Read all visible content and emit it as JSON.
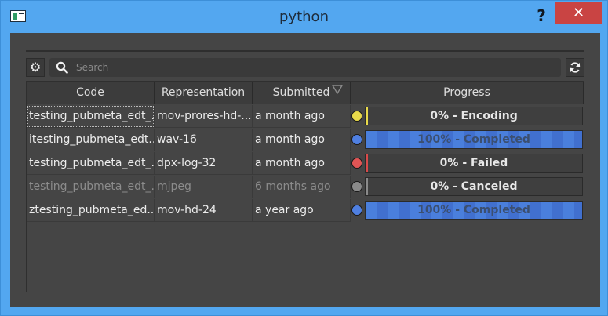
{
  "window": {
    "title": "python",
    "help_label": "?",
    "close_label": "✕"
  },
  "toolbar": {
    "search_placeholder": "Search",
    "search_value": ""
  },
  "table": {
    "columns": [
      "Code",
      "Representation",
      "Submitted",
      "Progress"
    ],
    "sort_column": "Submitted",
    "rows": [
      {
        "code": "testing_pubmeta_edt_...",
        "representation": "mov-prores-hd-...",
        "submitted": "a month ago",
        "status_color": "#e8d94a",
        "progress_percent": 0,
        "progress_text": "0% - Encoding",
        "bar_color": "#e8d94a"
      },
      {
        "code": "itesting_pubmeta_edt...",
        "representation": "wav-16",
        "submitted": "a month ago",
        "status_color": "#4f7fe0",
        "progress_percent": 100,
        "progress_text": "100% - Completed",
        "bar_color": "#4a7fdc"
      },
      {
        "code": "testing_pubmeta_edt_...",
        "representation": "dpx-log-32",
        "submitted": "a month ago",
        "status_color": "#e05555",
        "progress_percent": 0,
        "progress_text": "0% - Failed",
        "bar_color": "#d94a4a"
      },
      {
        "code": "testing_pubmeta_edt_...",
        "representation": "mjpeg",
        "submitted": "6 months ago",
        "status_color": "#8a8a8a",
        "progress_percent": 0,
        "progress_text": "0% - Canceled",
        "bar_color": "#8a8a8a"
      },
      {
        "code": "ztesting_pubmeta_ed...",
        "representation": "mov-hd-24",
        "submitted": "a year ago",
        "status_color": "#4f7fe0",
        "progress_percent": 100,
        "progress_text": "100% - Completed",
        "bar_color": "#4a7fdc"
      }
    ]
  }
}
